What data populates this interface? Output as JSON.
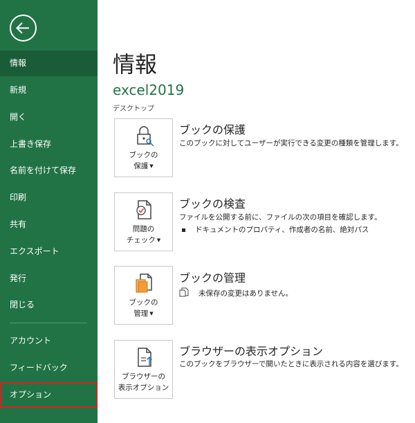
{
  "sidebar": {
    "items": [
      {
        "label": "情報"
      },
      {
        "label": "新規"
      },
      {
        "label": "開く"
      },
      {
        "label": "上書き保存"
      },
      {
        "label": "名前を付けて保存"
      },
      {
        "label": "印刷"
      },
      {
        "label": "共有"
      },
      {
        "label": "エクスポート"
      },
      {
        "label": "発行"
      },
      {
        "label": "閉じる"
      },
      {
        "label": "アカウント"
      },
      {
        "label": "フィードバック"
      },
      {
        "label": "オプション"
      }
    ]
  },
  "main": {
    "title": "情報",
    "workbook_name": "excel2019",
    "workbook_location": "デスクトップ",
    "sections": [
      {
        "button_line1": "ブックの",
        "button_line2": "保護",
        "title": "ブックの保護",
        "description": "このブックに対してユーザーが実行できる変更の種類を管理します。"
      },
      {
        "button_line1": "問題の",
        "button_line2": "チェック",
        "title": "ブックの検査",
        "description": "ファイルを公開する前に、ファイルの次の項目を確認します。",
        "bullet": "ドキュメントのプロパティ、作成者の名前、絶対パス"
      },
      {
        "button_line1": "ブックの",
        "button_line2": "管理",
        "title": "ブックの管理",
        "description": "未保存の変更はありません。"
      },
      {
        "button_line1": "ブラウザーの",
        "button_line2": "表示オプション",
        "title": "ブラウザーの表示オプション",
        "description": "このブックをブラウザーで開いたときに表示される内容を選びます。"
      }
    ]
  },
  "colors": {
    "sidebar_bg": "#217346",
    "sidebar_selected": "#1a5c38",
    "accent": "#217346",
    "highlight_border": "#d9211f"
  },
  "icons": {
    "back": "back-arrow-icon",
    "protect": "lock-key-icon",
    "inspect": "document-check-icon",
    "manage": "document-stack-icon",
    "browser": "document-upload-icon",
    "no_changes": "document-copy-icon"
  }
}
